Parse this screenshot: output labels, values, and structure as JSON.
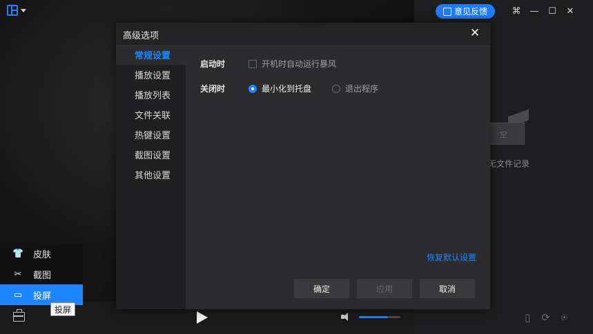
{
  "player": {
    "list_icon": "playlist-icon",
    "feedback_label": "意见反馈",
    "play_icon": "play-icon",
    "volume_level": 0.7
  },
  "sidebar": {
    "empty_box_text": "空",
    "empty_label": "无文件记录"
  },
  "tools_menu": {
    "items": [
      {
        "label": "皮肤",
        "icon": "shirt-icon"
      },
      {
        "label": "截图",
        "icon": "scissors-icon"
      },
      {
        "label": "投屏",
        "icon": "cast-icon"
      }
    ],
    "tooltip": "投屏"
  },
  "dialog": {
    "title": "高级选项",
    "nav": [
      "常规设置",
      "播放设置",
      "播放列表",
      "文件关联",
      "热键设置",
      "截图设置",
      "其他设置"
    ],
    "startup_label": "启动时",
    "startup_option": "开机时自动运行暴风",
    "close_label": "关闭时",
    "close_option_1": "最小化到托盘",
    "close_option_2": "退出程序",
    "restore_defaults": "恢复默认设置",
    "ok": "确定",
    "apply": "应用",
    "cancel": "取消"
  },
  "colors": {
    "accent": "#1f84ff",
    "bg": "#1a1a1b",
    "dialog": "#2c2c2e"
  }
}
